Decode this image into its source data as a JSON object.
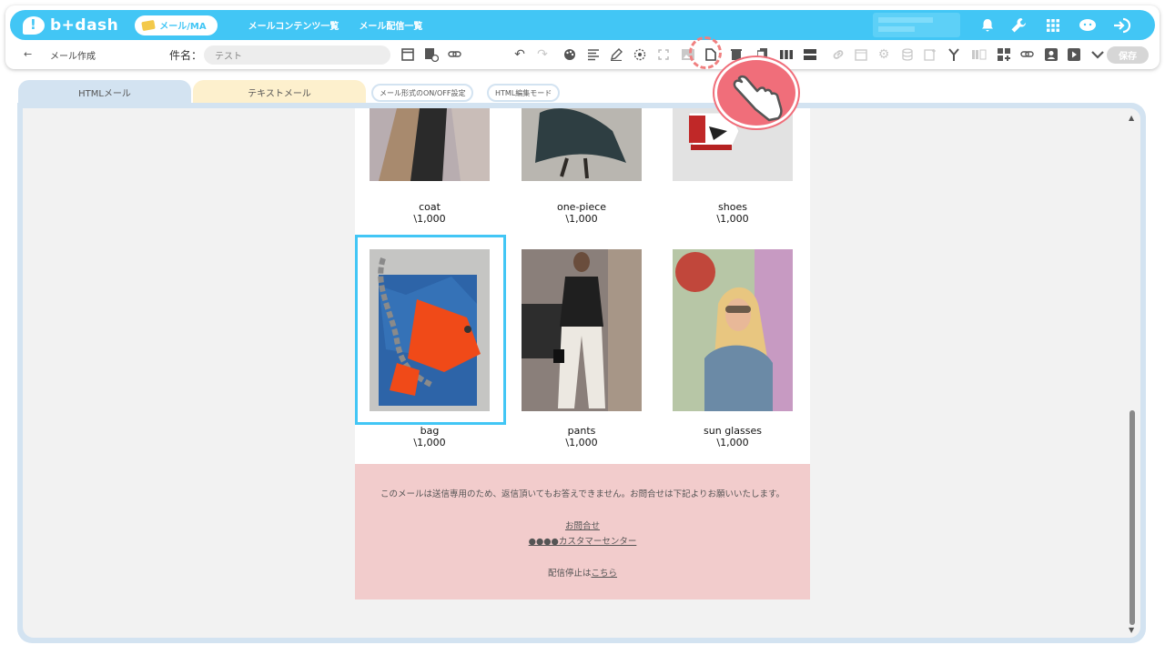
{
  "header": {
    "logo_text": "b+dash",
    "mode_pill": "メール/MA",
    "nav": [
      "メールコンテンツ一覧",
      "メール配信一覧"
    ]
  },
  "toolbar": {
    "back_label": "メール作成",
    "subject_label": "件名：",
    "subject_value": "テスト",
    "save_label": "保存"
  },
  "tabs": {
    "html": "HTMLメール",
    "text": "テキストメール",
    "format_toggle": "メール形式のON/OFF設定",
    "html_edit": "HTML編集モード"
  },
  "products_top": [
    {
      "name": "coat",
      "price": "\\1,000"
    },
    {
      "name": "one-piece",
      "price": "\\1,000"
    },
    {
      "name": "shoes",
      "price": "\\1,000"
    }
  ],
  "products_bottom": [
    {
      "name": "bag",
      "price": "\\1,000"
    },
    {
      "name": "pants",
      "price": "\\1,000"
    },
    {
      "name": "sun glasses",
      "price": "\\1,000"
    }
  ],
  "footer": {
    "notice": "このメールは送信専用のため、返信頂いてもお答えできません。お問合せは下記よりお願いいたします。",
    "contact_link": "お問合せ",
    "center_link": "●●●●カスタマーセンター",
    "unsub_prefix": "配信停止は",
    "unsub_link": "こちら"
  },
  "colors": {
    "brand": "#42c6f5",
    "tab_html": "#d3e3f1",
    "tab_text": "#fdf0cd",
    "footer_bg": "#f2cccc",
    "highlight": "#f06e7a"
  }
}
